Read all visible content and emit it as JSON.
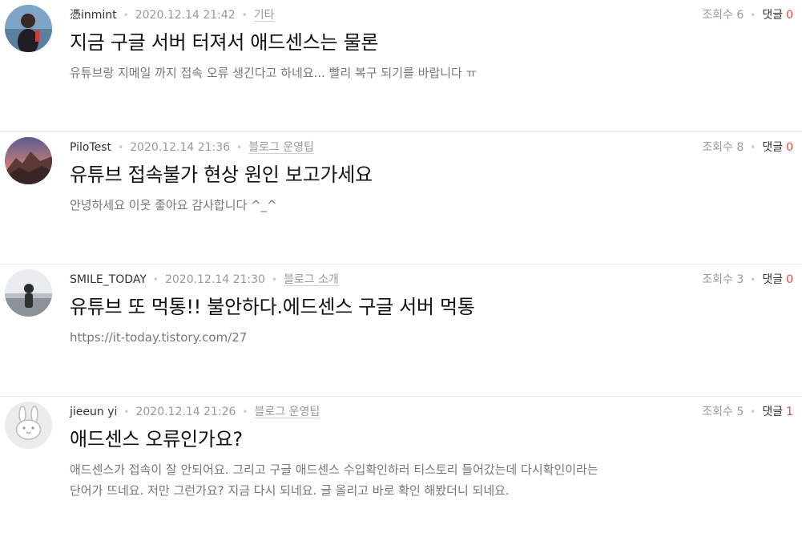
{
  "posts": [
    {
      "author": "憑inmint",
      "date": "2020.12.14 21:42",
      "category": "기타",
      "views": "조회수 6",
      "comments_label": "댓글",
      "comments_count": "0",
      "title": "지금 구글 서버 터져서 애드센스는 물론",
      "excerpt": "유튜브랑 지메일 까지 접속 오류 생긴다고 하네요... 빨리 복구 되기를 바랍니다 ㅠ",
      "avatar_icon": "profile-photo-icon"
    },
    {
      "author": "PiloTest",
      "date": "2020.12.14 21:36",
      "category": "블로그 운영팁",
      "views": "조회수 8",
      "comments_label": "댓글",
      "comments_count": "0",
      "title": "유튜브 접속불가 현상 원인 보고가세요",
      "excerpt": "안녕하세요 이웃 좋아요 감사합니다 ^_^",
      "avatar_icon": "mountain-icon"
    },
    {
      "author": "SMILE_TODAY",
      "date": "2020.12.14 21:30",
      "category": "블로그 소개",
      "views": "조회수 3",
      "comments_label": "댓글",
      "comments_count": "0",
      "title": "유튜브 또 먹통!! 불안하다.에드센스 구글 서버 먹통",
      "excerpt": "https://it-today.tistory.com/27",
      "avatar_icon": "person-photo-icon"
    },
    {
      "author": "jieeun yi",
      "date": "2020.12.14 21:26",
      "category": "블로그 운영팁",
      "views": "조회수 5",
      "comments_label": "댓글",
      "comments_count": "1",
      "title": "애드센스 오류인가요?",
      "excerpt": "애드센스가 접속이 잘 안되어요. 그리고 구글 애드센스 수입확인하러 티스토리 들어갔는데 다시확인이라는 단어가 뜨네요. 저만 그런가요? 지금 다시 되네요. 글 올리고 바로 확인 해봤더니 되네요.",
      "avatar_icon": "bunny-icon"
    }
  ],
  "colors": {
    "comment_count": "#e54a3b",
    "muted": "#999999",
    "divider": "#e6e6e6"
  }
}
